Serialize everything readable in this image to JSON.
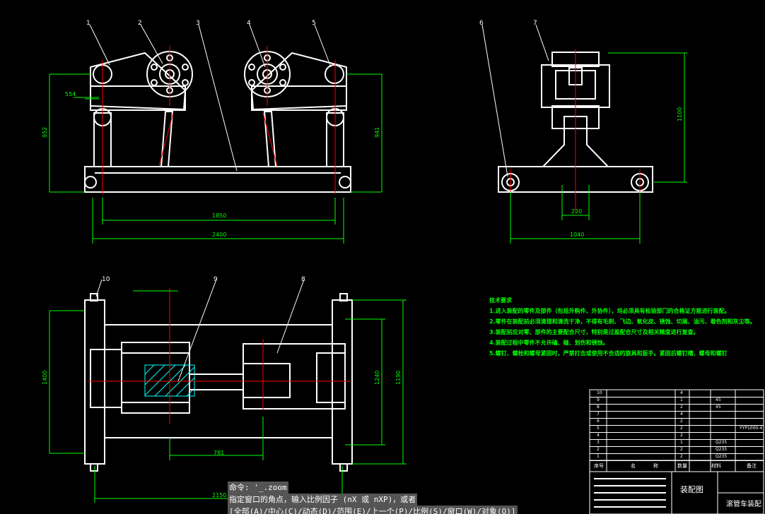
{
  "drawing": {
    "front_view": {
      "balloons": [
        "1",
        "2",
        "3",
        "4",
        "5"
      ],
      "dims": {
        "d554": "554",
        "d952": "952",
        "d941": "941",
        "d1850": "1850",
        "d2400": "2400"
      }
    },
    "side_view": {
      "balloons": [
        "6",
        "7"
      ],
      "dims": {
        "d1100": "1100",
        "d220": "220",
        "d1040": "1040"
      }
    },
    "plan_view": {
      "balloons": [
        "10",
        "9",
        "8"
      ],
      "dims": {
        "d1400": "1400",
        "d1240": "1240",
        "d1190": "1190",
        "d781": "781",
        "d2150": "2150"
      }
    }
  },
  "tech_requirements": {
    "title": "技术要求",
    "items": [
      "1.进入装配的零件及部件（包括外购件、外协件），均必须具有检验部门的合格证方能进行装配。",
      "2.零件在装配前必须清理和清洗干净，不得有毛刺、飞边、氧化皮、锈蚀、切屑、油污、着色剂和灰尘等。",
      "3.装配前应对零、部件的主要配合尺寸，特别是过盈配合尺寸及相关精度进行复查。",
      "4.装配过程中零件不允许磕、碰、划伤和锈蚀。",
      "5.螺钉、螺栓和螺母紧固时，严禁打击或使用不合适的旋具和扳手。紧固后螺钉槽、螺母和螺钉"
    ]
  },
  "title_block": {
    "header_cols": [
      "序号",
      "名",
      "称",
      "数量",
      "材料",
      "备注"
    ],
    "rows": [
      {
        "no": "10",
        "qty": "4",
        "mat": "",
        "note": ""
      },
      {
        "no": "9",
        "qty": "1",
        "mat": "45",
        "note": ""
      },
      {
        "no": "8",
        "qty": "2",
        "mat": "45",
        "note": ""
      },
      {
        "no": "7",
        "qty": "4",
        "mat": "",
        "note": ""
      },
      {
        "no": "6",
        "qty": "2",
        "mat": "",
        "note": ""
      },
      {
        "no": "5",
        "qty": "2",
        "mat": "",
        "note": "YYP1000-4"
      },
      {
        "no": "4",
        "qty": "2",
        "mat": "",
        "note": ""
      },
      {
        "no": "3",
        "qty": "1",
        "mat": "Q235",
        "note": ""
      },
      {
        "no": "2",
        "qty": "2",
        "mat": "Q235",
        "note": ""
      },
      {
        "no": "1",
        "qty": "2",
        "mat": "Q235",
        "note": ""
      }
    ],
    "drawing_label": "装配图",
    "drawing_name": "滚管车装配"
  },
  "command_line": {
    "line1": "命令: '_.zoom",
    "line2": "指定窗口的角点，输入比例因子 (nX 或 nXP)，或者",
    "line3": "[全部(A)/中心(C)/动态(D)/范围(E)/上一个(P)/比例(S)/窗口(W)/对象(O)]"
  },
  "colors": {
    "background": "#000000",
    "geometry": "#ffffff",
    "dimension": "#00ff00",
    "centerline": "#ff0000",
    "hatch": "#00ffff"
  }
}
